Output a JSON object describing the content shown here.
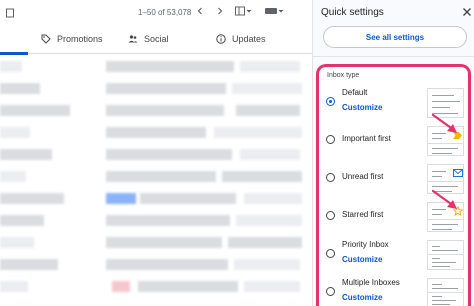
{
  "toolbar": {
    "pager": "1–50 of 53,078"
  },
  "tabs": [
    {
      "label": "Promotions",
      "icon": "tag-icon"
    },
    {
      "label": "Social",
      "icon": "people-icon"
    },
    {
      "label": "Updates",
      "icon": "info-icon"
    }
  ],
  "quick_settings": {
    "title": "Quick settings",
    "see_all": "See all settings",
    "section": "Inbox type",
    "options": [
      {
        "label": "Default",
        "link": "Customize",
        "selected": true
      },
      {
        "label": "Important first",
        "selected": false
      },
      {
        "label": "Unread first",
        "selected": false
      },
      {
        "label": "Starred first",
        "selected": false
      },
      {
        "label": "Priority Inbox",
        "link": "Customize",
        "selected": false
      },
      {
        "label": "Multiple Inboxes",
        "link": "Customize",
        "selected": false
      }
    ]
  },
  "colors": {
    "accent": "#0b57d0",
    "highlight_frame": "#e5326a",
    "important_marker": "#f4b400",
    "unread_envelope": "#1a73e8",
    "star": "#f4b400"
  }
}
